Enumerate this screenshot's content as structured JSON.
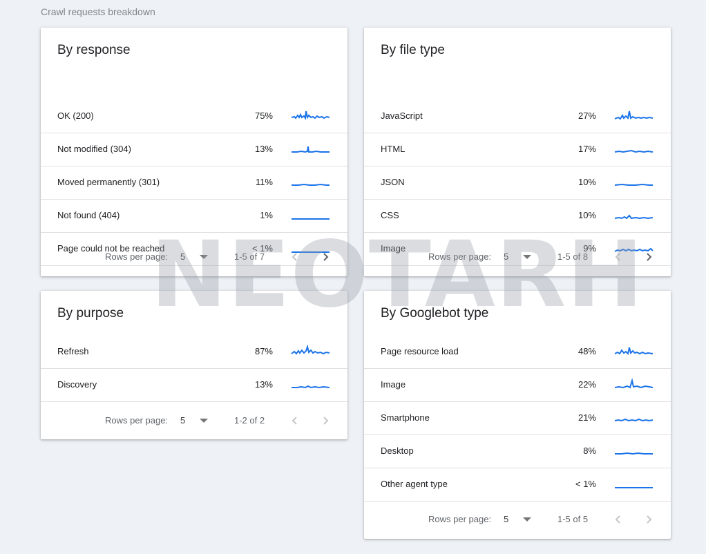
{
  "section_title": "Crawl requests breakdown",
  "watermark": "NEOTARH",
  "cards": {
    "response": {
      "title": "By response",
      "rows": [
        {
          "label": "OK (200)",
          "pct": "75%"
        },
        {
          "label": "Not modified (304)",
          "pct": "13%"
        },
        {
          "label": "Moved permanently (301)",
          "pct": "11%"
        },
        {
          "label": "Not found (404)",
          "pct": "1%"
        },
        {
          "label": "Page could not be reached",
          "pct": "< 1%"
        }
      ],
      "footer": {
        "rows_per_page_label": "Rows per page:",
        "rows_per_page": "5",
        "range": "1-5 of 7"
      }
    },
    "file_type": {
      "title": "By file type",
      "rows": [
        {
          "label": "JavaScript",
          "pct": "27%"
        },
        {
          "label": "HTML",
          "pct": "17%"
        },
        {
          "label": "JSON",
          "pct": "10%"
        },
        {
          "label": "CSS",
          "pct": "10%"
        },
        {
          "label": "Image",
          "pct": "9%"
        }
      ],
      "footer": {
        "rows_per_page_label": "Rows per page:",
        "rows_per_page": "5",
        "range": "1-5 of 8"
      }
    },
    "purpose": {
      "title": "By purpose",
      "rows": [
        {
          "label": "Refresh",
          "pct": "87%"
        },
        {
          "label": "Discovery",
          "pct": "13%"
        }
      ],
      "footer": {
        "rows_per_page_label": "Rows per page:",
        "rows_per_page": "5",
        "range": "1-2 of 2"
      }
    },
    "googlebot": {
      "title": "By Googlebot type",
      "rows": [
        {
          "label": "Page resource load",
          "pct": "48%"
        },
        {
          "label": "Image",
          "pct": "22%"
        },
        {
          "label": "Smartphone",
          "pct": "21%"
        },
        {
          "label": "Desktop",
          "pct": "8%"
        },
        {
          "label": "Other agent type",
          "pct": "< 1%"
        }
      ],
      "footer": {
        "rows_per_page_label": "Rows per page:",
        "rows_per_page": "5",
        "range": "1-5 of 5"
      }
    }
  },
  "colors": {
    "sparkline": "#1a73e8",
    "nav_enabled": "#5f6368",
    "nav_disabled": "#c4c7c5"
  }
}
